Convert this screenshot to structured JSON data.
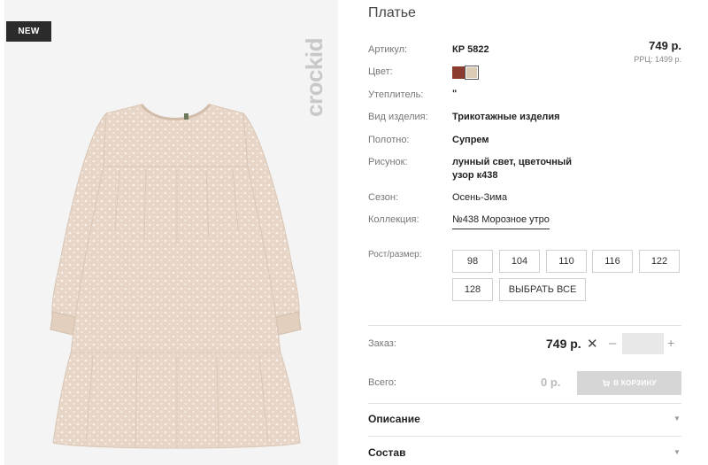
{
  "product": {
    "badge": "NEW",
    "brand": "crockid",
    "title": "Платье",
    "price": "749 р.",
    "rrp": "РРЦ: 1499 р."
  },
  "specs": {
    "article_label": "Артикул:",
    "article_value": "КР 5822",
    "color_label": "Цвет:",
    "colors": [
      "#8b3a2e",
      "#dccbb4"
    ],
    "insulation_label": "Утеплитель:",
    "insulation_value": "\"",
    "type_label": "Вид изделия:",
    "type_value": "Трикотажные изделия",
    "fabric_label": "Полотно:",
    "fabric_value": "Супрем",
    "pattern_label": "Рисунок:",
    "pattern_line1": "лунный свет, цветочный",
    "pattern_line2": "узор к438",
    "season_label": "Сезон:",
    "season_value": "Осень-Зима",
    "collection_label": "Коллекция:",
    "collection_value": "№438 Морозное утро"
  },
  "sizes": {
    "label": "Рост/размер:",
    "items": [
      "98",
      "104",
      "110",
      "116",
      "122",
      "128"
    ],
    "select_all": "ВЫБРАТЬ ВСЕ"
  },
  "order": {
    "label": "Заказ:",
    "price": "749 р.",
    "times": "✕",
    "minus": "–",
    "plus": "+",
    "quantity": ""
  },
  "total": {
    "label": "Всего:",
    "value": "0 р.",
    "cart_button": "В КОРЗИНУ",
    "cart_icon": "cart-icon"
  },
  "accordion": {
    "description": "Описание",
    "composition": "Состав",
    "arrow_icon": "triangle-down-icon"
  }
}
